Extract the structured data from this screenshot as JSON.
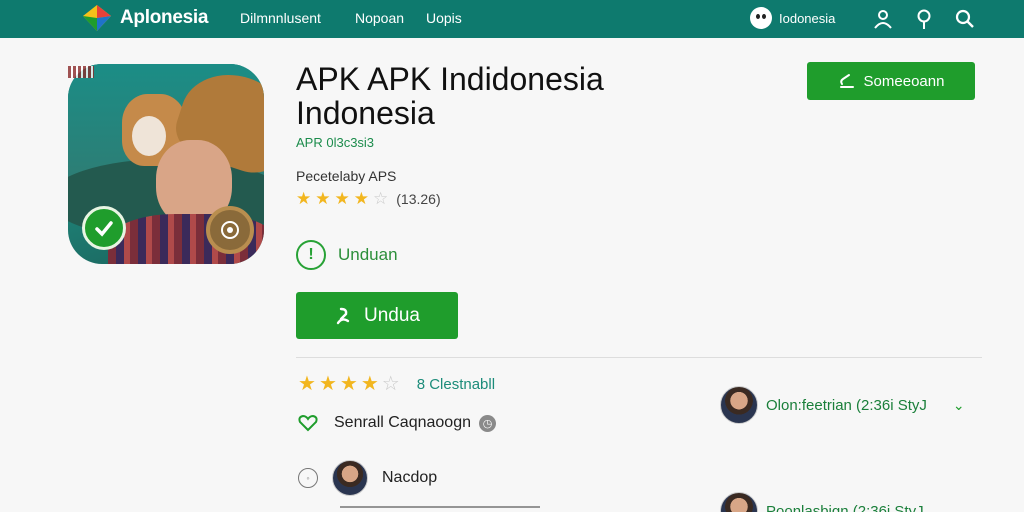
{
  "header": {
    "brand": "Aplonesia",
    "nav": [
      "Dilmnnlusent",
      "Nopoan",
      "Uopis"
    ],
    "region": "Iodonesia",
    "bg_color": "#0e7a6e"
  },
  "icons": {
    "logo": "diamond-logo-icon",
    "region": "face-icon",
    "user": "user-icon",
    "pin": "location-pin-icon",
    "search": "search-icon"
  },
  "app": {
    "title": "APK APK Indidonesia Indonesia",
    "developer": "APR 0l3c3si3",
    "category": "Pecetelaby APS",
    "rating_stars": 4.5,
    "rating_count": "(13.26)",
    "top_button": "Someeoann",
    "status_label": "Unduan",
    "download_button": "Undua"
  },
  "details": {
    "rating_stars": 4,
    "rating_label": "8 Clestnabll",
    "feature_label": "Senrall Caqnaoogn",
    "user_label": "Nacdop"
  },
  "reviews": [
    {
      "text": "Olon:feetrian (2:36i StyJ"
    },
    {
      "text": "Poonlasbign (2:36i StyJ"
    }
  ],
  "colors": {
    "accent": "#1f9d2c",
    "star": "#f2b61f"
  }
}
